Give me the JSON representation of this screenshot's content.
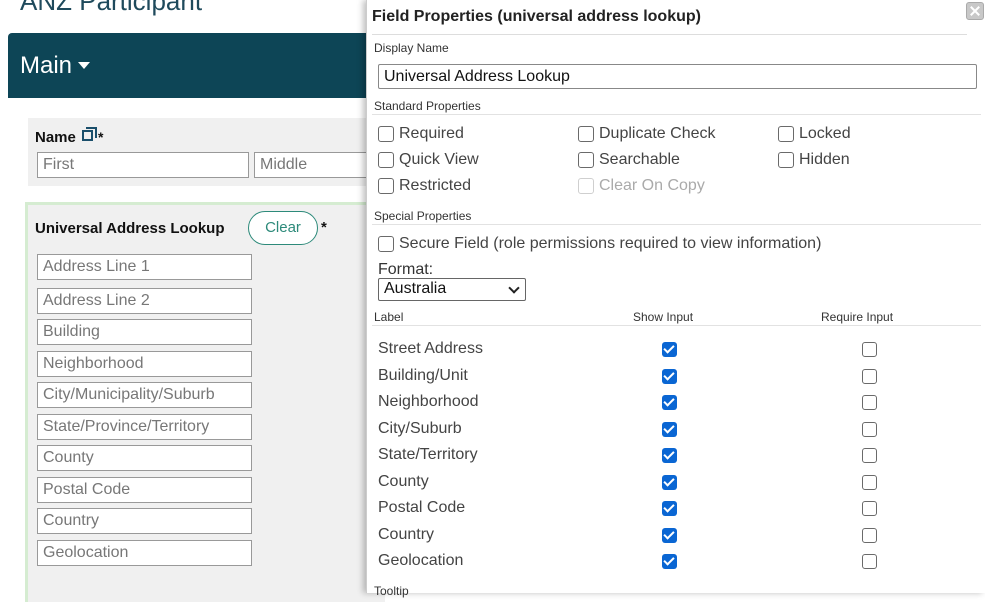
{
  "page": {
    "title": "ANZ Participant",
    "main_label": "Main"
  },
  "name_field": {
    "label": "Name",
    "required_mark": "*",
    "inputs": [
      "First",
      "Middle"
    ]
  },
  "address_field": {
    "label": "Universal Address Lookup",
    "clear_label": "Clear",
    "required_mark": "*",
    "inputs": [
      "Address Line 1",
      "Address Line 2",
      "Building",
      "Neighborhood",
      "City/Municipality/Suburb",
      "State/Province/Territory",
      "County",
      "Postal Code",
      "Country",
      "Geolocation"
    ]
  },
  "dialog": {
    "title": "Field Properties (universal address lookup)",
    "display_name_label": "Display Name",
    "display_name_value": "Universal Address Lookup",
    "standard_label": "Standard Properties",
    "standard": [
      {
        "label": "Required",
        "checked": false,
        "disabled": false
      },
      {
        "label": "Duplicate Check",
        "checked": false,
        "disabled": false
      },
      {
        "label": "Locked",
        "checked": false,
        "disabled": false
      },
      {
        "label": "Quick View",
        "checked": false,
        "disabled": false
      },
      {
        "label": "Searchable",
        "checked": false,
        "disabled": false
      },
      {
        "label": "Hidden",
        "checked": false,
        "disabled": false
      },
      {
        "label": "Restricted",
        "checked": false,
        "disabled": false
      },
      {
        "label": "Clear On Copy",
        "checked": false,
        "disabled": true
      }
    ],
    "special_label": "Special Properties",
    "secure_label": "Secure Field (role permissions required to view information)",
    "format_label": "Format:",
    "format_value": "Australia",
    "columns": {
      "label": "Label",
      "show": "Show Input",
      "require": "Require Input"
    },
    "rows": [
      {
        "label": "Street Address",
        "show": true,
        "require": false
      },
      {
        "label": "Building/Unit",
        "show": true,
        "require": false
      },
      {
        "label": "Neighborhood",
        "show": true,
        "require": false
      },
      {
        "label": "City/Suburb",
        "show": true,
        "require": false
      },
      {
        "label": "State/Territory",
        "show": true,
        "require": false
      },
      {
        "label": "County",
        "show": true,
        "require": false
      },
      {
        "label": "Postal Code",
        "show": true,
        "require": false
      },
      {
        "label": "Country",
        "show": true,
        "require": false
      },
      {
        "label": "Geolocation",
        "show": true,
        "require": false
      }
    ],
    "tooltip_label": "Tooltip"
  },
  "colors": {
    "header_bar": "#0d4556",
    "accent_teal": "#2d8a7a",
    "checkbox_blue": "#0a66d3",
    "panel_gray": "#f0f0f0"
  }
}
